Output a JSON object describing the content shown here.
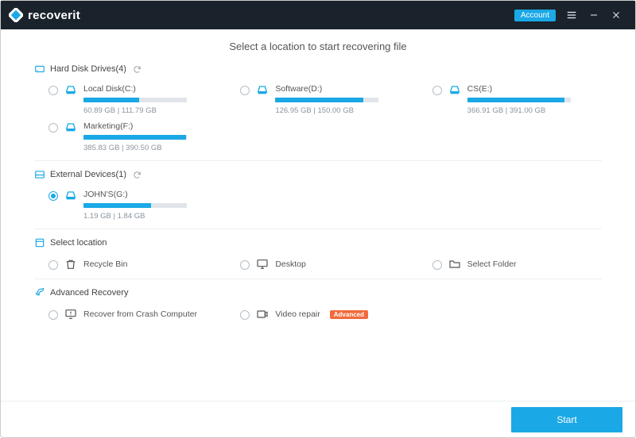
{
  "app": {
    "name": "recoverit",
    "account_label": "Account"
  },
  "page_title": "Select a location to start recovering file",
  "sections": {
    "hdd": {
      "label": "Hard Disk Drives(4)"
    },
    "ext": {
      "label": "External Devices(1)"
    },
    "loc": {
      "label": "Select location"
    },
    "adv": {
      "label": "Advanced Recovery"
    }
  },
  "drives": [
    {
      "name": "Local Disk(C:)",
      "used": 60.89,
      "total": 111.79,
      "stats": "60.89  GB | 111.79  GB",
      "pct": 54,
      "selected": false
    },
    {
      "name": "Software(D:)",
      "used": 126.95,
      "total": 150.0,
      "stats": "126.95  GB | 150.00  GB",
      "pct": 85,
      "selected": false
    },
    {
      "name": "CS(E:)",
      "used": 366.91,
      "total": 391.0,
      "stats": "366.91  GB | 391.00  GB",
      "pct": 94,
      "selected": false
    },
    {
      "name": "Marketing(F:)",
      "used": 385.83,
      "total": 390.5,
      "stats": "385.83  GB | 390.50  GB",
      "pct": 99,
      "selected": false
    }
  ],
  "external": [
    {
      "name": "JOHN'S(G:)",
      "used": 1.19,
      "total": 1.84,
      "stats": "1.19  GB | 1.84  GB",
      "pct": 65,
      "selected": true
    }
  ],
  "locations": [
    {
      "name": "Recycle Bin",
      "icon": "recycle"
    },
    {
      "name": "Desktop",
      "icon": "desktop"
    },
    {
      "name": "Select Folder",
      "icon": "folder"
    }
  ],
  "advanced": [
    {
      "name": "Recover from Crash Computer",
      "icon": "crash",
      "badge": null
    },
    {
      "name": "Video repair",
      "icon": "video",
      "badge": "Advanced"
    }
  ],
  "start_label": "Start"
}
